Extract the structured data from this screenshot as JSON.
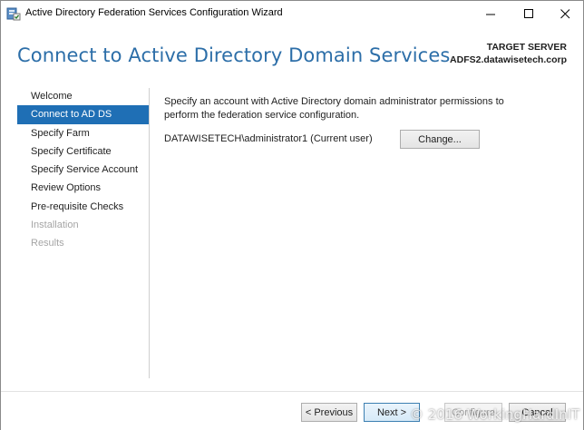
{
  "window": {
    "title": "Active Directory Federation Services Configuration Wizard",
    "icons": {
      "app": "server-wizard-icon",
      "minimize": "minimize-icon",
      "maximize": "maximize-icon",
      "close": "close-icon"
    }
  },
  "header": {
    "page_title": "Connect to Active Directory Domain Services",
    "target_label": "TARGET SERVER",
    "target_server": "ADFS2.datawisetech.corp"
  },
  "nav": {
    "items": [
      {
        "label": "Welcome",
        "state": "normal"
      },
      {
        "label": "Connect to AD DS",
        "state": "active"
      },
      {
        "label": "Specify Farm",
        "state": "normal"
      },
      {
        "label": "Specify Certificate",
        "state": "normal"
      },
      {
        "label": "Specify Service Account",
        "state": "normal"
      },
      {
        "label": "Review Options",
        "state": "normal"
      },
      {
        "label": "Pre-requisite Checks",
        "state": "normal"
      },
      {
        "label": "Installation",
        "state": "disabled"
      },
      {
        "label": "Results",
        "state": "disabled"
      }
    ]
  },
  "main": {
    "description": "Specify an account with Active Directory domain administrator permissions to perform the federation service configuration.",
    "account": "DATAWISETECH\\administrator1 (Current user)",
    "change_label": "Change..."
  },
  "footer": {
    "previous_label": "< Previous",
    "next_label": "Next >",
    "configure_label": "Configure",
    "cancel_label": "Cancel"
  },
  "watermark": "© 2016 WorkingHardInIT",
  "colors": {
    "title_blue": "#2c6ea8",
    "active_nav": "#1f6fb5",
    "disabled_text": "#a5a5a5"
  }
}
